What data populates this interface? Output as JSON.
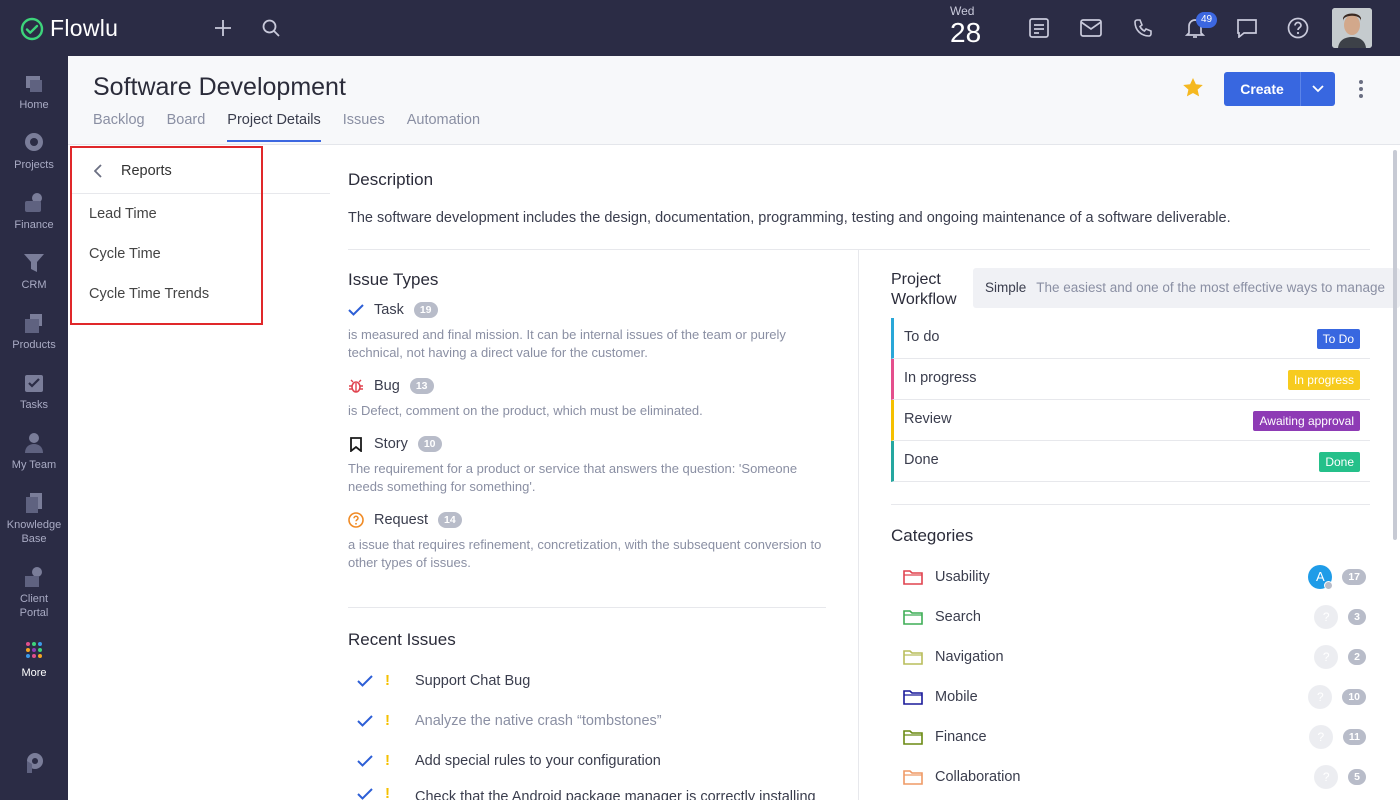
{
  "app": {
    "name": "Flowlu"
  },
  "topbar": {
    "day": "Wed",
    "date": "28",
    "notifications": "49"
  },
  "nav": [
    {
      "label": "Home",
      "icon": "home-icon"
    },
    {
      "label": "Projects",
      "icon": "projects-icon"
    },
    {
      "label": "Finance",
      "icon": "finance-icon"
    },
    {
      "label": "CRM",
      "icon": "crm-icon"
    },
    {
      "label": "Products",
      "icon": "products-icon"
    },
    {
      "label": "Tasks",
      "icon": "tasks-icon"
    },
    {
      "label": "My Team",
      "icon": "team-icon"
    },
    {
      "label": "Knowledge Base",
      "icon": "knowledge-base-icon"
    },
    {
      "label": "Client Portal",
      "icon": "client-portal-icon"
    },
    {
      "label": "More",
      "icon": "more-dots-icon"
    }
  ],
  "header": {
    "title": "Software Development",
    "tabs": [
      "Backlog",
      "Board",
      "Project Details",
      "Issues",
      "Automation"
    ],
    "active_tab": "Project Details",
    "create_label": "Create"
  },
  "reports": {
    "title": "Reports",
    "items": [
      "Lead Time",
      "Cycle Time",
      "Cycle Time Trends"
    ]
  },
  "description": {
    "title": "Description",
    "text": "The software development includes the design, documentation, programming, testing and ongoing maintenance of a software deliverable."
  },
  "issue_types": {
    "title": "Issue Types",
    "items": [
      {
        "name": "Task",
        "count": "19",
        "desc": "is measured and final mission. It can be internal issues of the team or purely technical, not having a direct value for the customer."
      },
      {
        "name": "Bug",
        "count": "13",
        "desc": "is Defect, comment on the product, which must be eliminated."
      },
      {
        "name": "Story",
        "count": "10",
        "desc": "The requirement for a product or service that answers the question: 'Someone needs something for something'."
      },
      {
        "name": "Request",
        "count": "14",
        "desc": "a issue that requires refinement, concretization, with the subsequent conversion to other types of issues."
      }
    ]
  },
  "recent_issues": {
    "title": "Recent Issues",
    "items": [
      "Support Chat Bug",
      "Analyze the native crash “tombstones”",
      "Add special rules to your configuration",
      "Check that the Android package manager is correctly installing"
    ]
  },
  "workflow": {
    "title_line1": "Project",
    "title_line2": "Workflow",
    "type": "Simple",
    "type_desc": "The easiest and one of the most effective ways to manage",
    "stages": [
      {
        "name": "To do",
        "tag": "To Do",
        "color": "#3867e0",
        "bar": "#29a7d8"
      },
      {
        "name": "In progress",
        "tag": "In progress",
        "color": "#f7cb1e",
        "bar": "#e44f8c"
      },
      {
        "name": "Review",
        "tag": "Awaiting approval",
        "color": "#8e3bb5",
        "bar": "#f5c000"
      },
      {
        "name": "Done",
        "tag": "Done",
        "color": "#25c08a",
        "bar": "#25a7a0"
      }
    ]
  },
  "categories": {
    "title": "Categories",
    "items": [
      {
        "name": "Usability",
        "count": "17",
        "color": "#e0434f",
        "assignee": "A"
      },
      {
        "name": "Search",
        "count": "3",
        "color": "#3fae56",
        "assignee": "?"
      },
      {
        "name": "Navigation",
        "count": "2",
        "color": "#b9bd5c",
        "assignee": "?"
      },
      {
        "name": "Mobile",
        "count": "10",
        "color": "#1a1a9a",
        "assignee": "?"
      },
      {
        "name": "Finance",
        "count": "11",
        "color": "#6b8a13",
        "assignee": "?"
      },
      {
        "name": "Collaboration",
        "count": "5",
        "color": "#ef9a66",
        "assignee": "?"
      }
    ]
  }
}
